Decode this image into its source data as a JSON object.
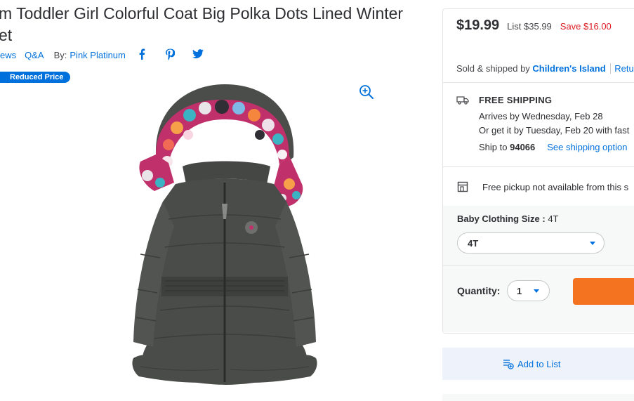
{
  "product": {
    "title": "m Toddler Girl Colorful Coat Big Polka Dots Lined Winter et",
    "title_line1": "m Toddler Girl Colorful Coat Big Polka Dots Lined Winter",
    "title_line2": "et",
    "reviews_link": "ews",
    "qa_link": "Q&A",
    "by_label": "By:",
    "brand": "Pink Platinum",
    "badge": "Reduced Price",
    "social_icons": [
      "facebook-icon",
      "pinterest-icon",
      "twitter-icon"
    ],
    "image_alt": "Toddler girl coat with polka dot lined hood"
  },
  "offer": {
    "price": "$19.99",
    "list_price": "List $35.99",
    "save": "Save $16.00",
    "sold_prefix": "Sold & shipped by",
    "seller": "Children's Island",
    "returns_link": "Return"
  },
  "shipping": {
    "title": "FREE SHIPPING",
    "arrives": "Arrives by Wednesday, Feb 28",
    "fast": "Or get it by Tuesday, Feb 20 with fast",
    "ship_to_label": "Ship to",
    "zip": "94066",
    "options_link": "See shipping option"
  },
  "pickup": {
    "text": "Free pickup not available from this s"
  },
  "variant": {
    "label": "Baby Clothing Size",
    "separator": ":",
    "selected_label": "4T",
    "select_value": "4T"
  },
  "quantity": {
    "label": "Quantity:",
    "value": "1"
  },
  "add_to_list": "Add to List",
  "colors": {
    "accent": "#0071dc",
    "save_red": "#de1c24",
    "cart_orange": "#f47321",
    "badge_blue": "#0071dc"
  }
}
